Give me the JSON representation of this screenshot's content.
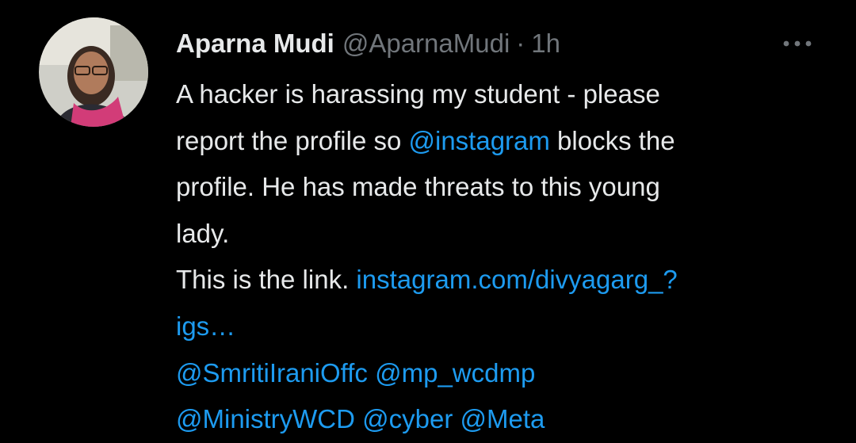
{
  "tweet": {
    "author_name": "Aparna Mudi",
    "handle": "@AparnaMudi",
    "separator": "·",
    "time": "1h",
    "more_icon": "more-horizontal-icon",
    "text": {
      "line1": "A hacker is harassing my student - please",
      "line2_pre": "report the profile so ",
      "line2_mention": "@instagram",
      "line2_post": " blocks the",
      "line3": "profile. He has made threats to this young",
      "line4": "lady.",
      "line5_pre": "This is the link. ",
      "line5_link": "instagram.com/divyagarg_?",
      "line6_link": "igs…",
      "mention_smriti": "@SmritiIraniOffc",
      "mention_mpwcd": "@mp_wcdmp",
      "mention_ministry": "@MinistryWCD",
      "mention_cyber": "@cyber",
      "mention_meta": "@Meta"
    }
  },
  "colors": {
    "background": "#000000",
    "text_primary": "#E7E9EA",
    "text_secondary": "#71767B",
    "link": "#1D9BF0"
  }
}
